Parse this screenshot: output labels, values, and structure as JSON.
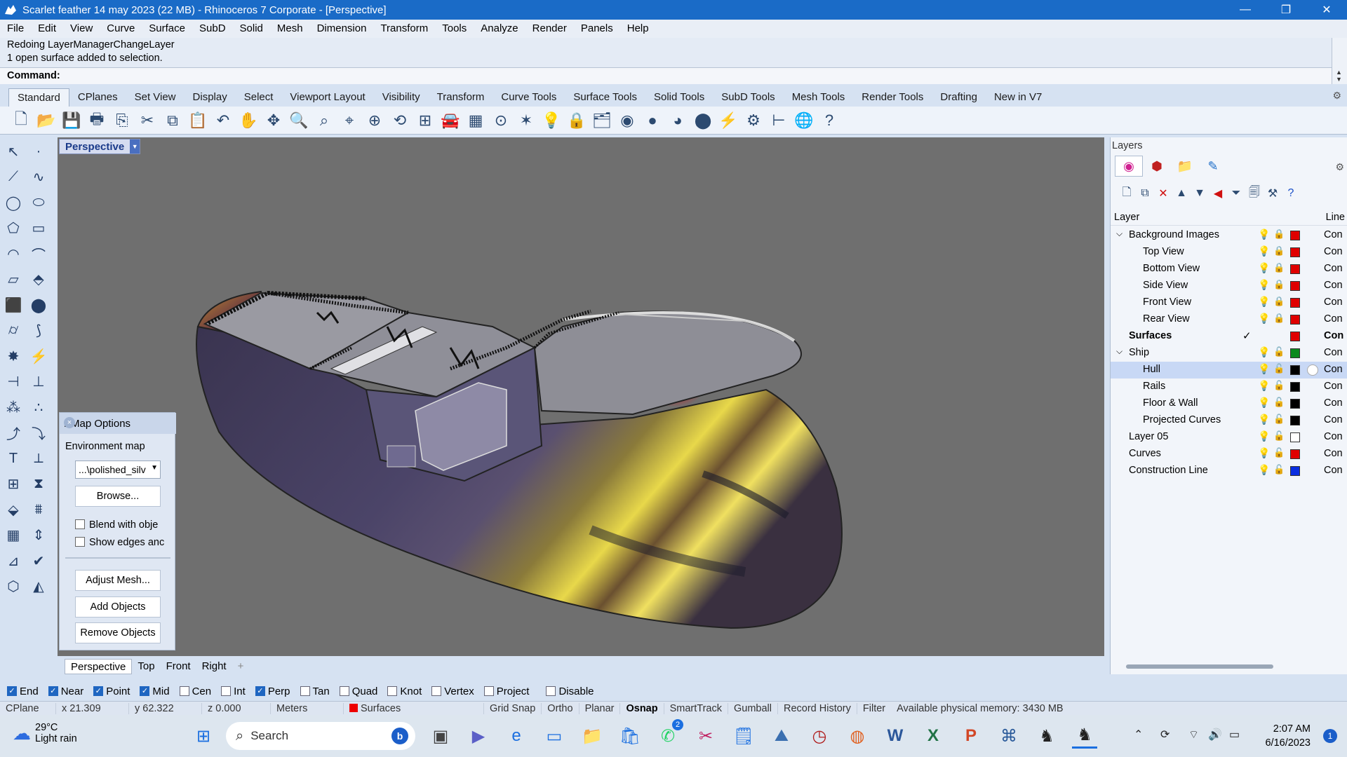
{
  "window": {
    "title": "Scarlet feather 14 may 2023 (22 MB) - Rhinoceros 7 Corporate - [Perspective]",
    "minimize": "—",
    "restore": "❐",
    "close": "✕"
  },
  "menu": [
    "File",
    "Edit",
    "View",
    "Curve",
    "Surface",
    "SubD",
    "Solid",
    "Mesh",
    "Dimension",
    "Transform",
    "Tools",
    "Analyze",
    "Render",
    "Panels",
    "Help"
  ],
  "command": {
    "history": [
      "Redoing LayerManagerChangeLayer",
      "1 open surface added to selection."
    ],
    "prompt": "Command:"
  },
  "toolbar_tabs": [
    "Standard",
    "CPlanes",
    "Set View",
    "Display",
    "Select",
    "Viewport Layout",
    "Visibility",
    "Transform",
    "Curve Tools",
    "Surface Tools",
    "Solid Tools",
    "SubD Tools",
    "Mesh Tools",
    "Render Tools",
    "Drafting",
    "New in V7"
  ],
  "toolbar_icons": [
    "new-icon",
    "open-icon",
    "save-icon",
    "print-icon",
    "export-icon",
    "cut-icon",
    "copy-icon",
    "paste-icon",
    "undo-icon",
    "pan-icon",
    "move-icon",
    "zoom-icon",
    "zoom-window-icon",
    "zoom-extents-icon",
    "zoom-selected-icon",
    "rotate-view-icon",
    "four-view-icon",
    "car-icon",
    "grid-icon",
    "cplane-icon",
    "gumball-icon",
    "light-icon",
    "lock-icon",
    "layer-icon",
    "color-wheel-icon",
    "shaded-icon",
    "rendered-icon",
    "material-icon",
    "snap-icon",
    "options-icon",
    "dimension-icon",
    "globe-icon",
    "help-icon"
  ],
  "toolbar_glyphs": [
    "🗋",
    "📂",
    "💾",
    "🖶",
    "⎘",
    "✂",
    "⧉",
    "📋",
    "↶",
    "✋",
    "✥",
    "🔍",
    "⌕",
    "⌖",
    "⊕",
    "⟲",
    "⊞",
    "🚘",
    "▦",
    "⊙",
    "✶",
    "💡",
    "🔒",
    "🗂",
    "◉",
    "●",
    "◕",
    "⬤",
    "⚡",
    "⚙",
    "⊢",
    "🌐",
    "?"
  ],
  "left_tools": [
    [
      "select-arrow-icon",
      "↖"
    ],
    [
      "point-icon",
      "·"
    ],
    [
      "polyline-icon",
      "⟋"
    ],
    [
      "curve-icon",
      "∿"
    ],
    [
      "circle-icon",
      "◯"
    ],
    [
      "ellipse-icon",
      "⬭"
    ],
    [
      "polygon-icon",
      "⬠"
    ],
    [
      "rectangle-icon",
      "▭"
    ],
    [
      "arc-icon",
      "◠"
    ],
    [
      "fillet-icon",
      "⌒"
    ],
    [
      "surface-icon",
      "▱"
    ],
    [
      "extrude-icon",
      "⬘"
    ],
    [
      "box-icon",
      "⬛"
    ],
    [
      "boolean-icon",
      "⬤"
    ],
    [
      "cylinder-icon",
      "⌭"
    ],
    [
      "pipe-icon",
      "⟆"
    ],
    [
      "explode-icon",
      "✸"
    ],
    [
      "split-icon",
      "⚡"
    ],
    [
      "trim-icon",
      "⊣"
    ],
    [
      "join-icon",
      "⊥"
    ],
    [
      "group-icon",
      "⁂"
    ],
    [
      "ungroup-icon",
      "∴"
    ],
    [
      "offset-icon",
      "⤴"
    ],
    [
      "blend-icon",
      "⤵"
    ],
    [
      "text-icon",
      "T"
    ],
    [
      "dimension-icon",
      "⟂"
    ],
    [
      "array-icon",
      "⊞"
    ],
    [
      "mirror-icon",
      "⧗"
    ],
    [
      "solid-edit-icon",
      "⬙"
    ],
    [
      "contour-icon",
      "⩩"
    ],
    [
      "array-grid-icon",
      "▦"
    ],
    [
      "scale-icon",
      "⇕"
    ],
    [
      "analyze-icon",
      "⊿"
    ],
    [
      "check-icon",
      "✔"
    ],
    [
      "mesh-icon",
      "⬡"
    ],
    [
      "render-icon",
      "◭"
    ]
  ],
  "viewport": {
    "name": "Perspective",
    "tabs": [
      "Perspective",
      "Top",
      "Front",
      "Right"
    ],
    "add_tab": "+"
  },
  "emap": {
    "title": "EMap Options",
    "close": "×",
    "group": "Environment map",
    "map_value": "...\\polished_silv",
    "browse": "Browse...",
    "blend_label": "Blend with obje",
    "edges_label": "Show edges anc",
    "adjust": "Adjust Mesh...",
    "add": "Add Objects",
    "remove": "Remove Objects"
  },
  "layers": {
    "title": "Layers",
    "col_layer": "Layer",
    "col_line": "Line",
    "rows": [
      {
        "name": "Background Images",
        "indent": 0,
        "twisty": "v",
        "color": "#e00000",
        "line": "Con",
        "bold": false,
        "selected": false,
        "current": false
      },
      {
        "name": "Top View",
        "indent": 1,
        "twisty": "",
        "color": "#e00000",
        "line": "Con",
        "bold": false,
        "selected": false,
        "current": false
      },
      {
        "name": "Bottom View",
        "indent": 1,
        "twisty": "",
        "color": "#e00000",
        "line": "Con",
        "bold": false,
        "selected": false,
        "current": false
      },
      {
        "name": "Side View",
        "indent": 1,
        "twisty": "",
        "color": "#e00000",
        "line": "Con",
        "bold": false,
        "selected": false,
        "current": false
      },
      {
        "name": "Front View",
        "indent": 1,
        "twisty": "",
        "color": "#e00000",
        "line": "Con",
        "bold": false,
        "selected": false,
        "current": false
      },
      {
        "name": "Rear View",
        "indent": 1,
        "twisty": "",
        "color": "#e00000",
        "line": "Con",
        "bold": false,
        "selected": false,
        "current": false
      },
      {
        "name": "Surfaces",
        "indent": 0,
        "twisty": "",
        "color": "#e00000",
        "line": "Con",
        "bold": true,
        "selected": false,
        "current": true
      },
      {
        "name": "Ship",
        "indent": 0,
        "twisty": "v",
        "color": "#0a8a1e",
        "line": "Con",
        "bold": false,
        "selected": false,
        "current": false
      },
      {
        "name": "Hull",
        "indent": 1,
        "twisty": "",
        "color": "#000000",
        "line": "Con",
        "bold": false,
        "selected": true,
        "current": false
      },
      {
        "name": "Rails",
        "indent": 1,
        "twisty": "",
        "color": "#000000",
        "line": "Con",
        "bold": false,
        "selected": false,
        "current": false
      },
      {
        "name": "Floor & Wall",
        "indent": 1,
        "twisty": "",
        "color": "#000000",
        "line": "Con",
        "bold": false,
        "selected": false,
        "current": false
      },
      {
        "name": "Projected Curves",
        "indent": 1,
        "twisty": "",
        "color": "#000000",
        "line": "Con",
        "bold": false,
        "selected": false,
        "current": false
      },
      {
        "name": "Layer 05",
        "indent": 0,
        "twisty": "",
        "color": "#ffffff",
        "line": "Con",
        "bold": false,
        "selected": false,
        "current": false
      },
      {
        "name": "Curves",
        "indent": 0,
        "twisty": "",
        "color": "#e00000",
        "line": "Con",
        "bold": false,
        "selected": false,
        "current": false
      },
      {
        "name": "Construction Line",
        "indent": 0,
        "twisty": "",
        "color": "#0a2ee0",
        "line": "Con",
        "bold": false,
        "selected": false,
        "current": false
      }
    ]
  },
  "osnap": [
    {
      "label": "End",
      "on": true
    },
    {
      "label": "Near",
      "on": true
    },
    {
      "label": "Point",
      "on": true
    },
    {
      "label": "Mid",
      "on": true
    },
    {
      "label": "Cen",
      "on": false
    },
    {
      "label": "Int",
      "on": false
    },
    {
      "label": "Perp",
      "on": true
    },
    {
      "label": "Tan",
      "on": false
    },
    {
      "label": "Quad",
      "on": false
    },
    {
      "label": "Knot",
      "on": false
    },
    {
      "label": "Vertex",
      "on": false
    },
    {
      "label": "Project",
      "on": false
    },
    {
      "label": "Disable",
      "on": false
    }
  ],
  "status": {
    "cplane": "CPlane",
    "x": "x 21.309",
    "y": "y 62.322",
    "z": "z 0.000",
    "units": "Meters",
    "layer": "Surfaces",
    "toggles": [
      "Grid Snap",
      "Ortho",
      "Planar",
      "Osnap",
      "SmartTrack",
      "Gumball",
      "Record History",
      "Filter"
    ],
    "memory": "Available physical memory: 3430 MB"
  },
  "taskbar": {
    "temp": "29°C",
    "weather": "Light rain",
    "search": "Search",
    "time": "2:07 AM",
    "date": "6/16/2023",
    "whatsapp_badge": "2",
    "notif": "1"
  }
}
